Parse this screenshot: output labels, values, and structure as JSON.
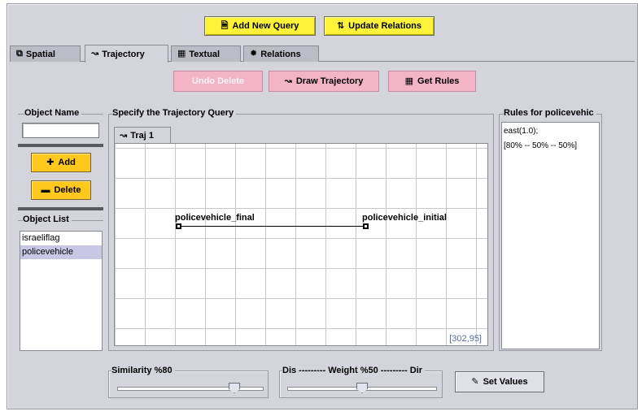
{
  "toolbar": {
    "add_query_label": "Add New Query",
    "update_relations_label": "Update Relations"
  },
  "tabs": [
    {
      "label": "Spatial",
      "icon": "spatial-icon"
    },
    {
      "label": "Trajectory",
      "icon": "trajectory-icon",
      "active": true
    },
    {
      "label": "Textual",
      "icon": "textual-icon"
    },
    {
      "label": "Relations",
      "icon": "relations-icon"
    }
  ],
  "actions": {
    "undo_delete_label": "Undo Delete",
    "draw_trajectory_label": "Draw Trajectory",
    "get_rules_label": "Get Rules"
  },
  "object_panel": {
    "name_title": "Object Name",
    "name_value": "",
    "add_label": "Add",
    "delete_label": "Delete",
    "list_title": "Object List",
    "items": [
      "israeliflag",
      "policevehicle"
    ],
    "selected_index": 1
  },
  "trajectory": {
    "title": "Specify the Trajectory Query",
    "tab_label": "Traj 1",
    "start_label": "policevehicle_final",
    "end_label": "policevehicle_initial",
    "coord_readout": "[302,95]"
  },
  "rules": {
    "title": "Rules for policevehic",
    "lines": [
      "east(1.0);",
      "[80% -- 50% -- 50%]"
    ]
  },
  "sliders": {
    "similarity_label": "Similarity %80",
    "similarity_value": 80,
    "weight_label": "Dis --------- Weight %50 --------- Dir",
    "weight_value": 50,
    "set_values_label": "Set Values"
  },
  "colors": {
    "window_bg": "#d4d4dc",
    "yellow_button": "#fff33a",
    "orange_button": "#ffc81c",
    "pink_button": "#f4b4c8",
    "list_selection": "#c8c8e6",
    "coord_text": "#5a6aa0"
  }
}
